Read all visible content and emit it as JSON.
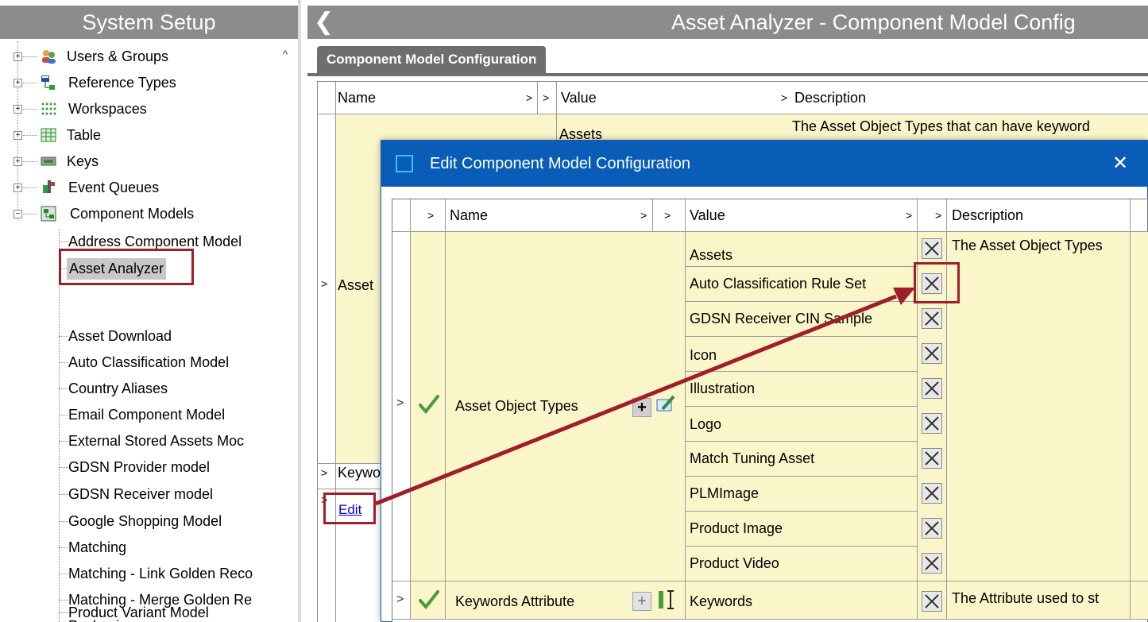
{
  "left_panel": {
    "title": "System Setup",
    "tree": [
      {
        "label": "Users & Groups",
        "icon": "users-groups-icon"
      },
      {
        "label": "Reference Types",
        "icon": "reference-types-icon"
      },
      {
        "label": "Workspaces",
        "icon": "workspaces-icon"
      },
      {
        "label": "Table",
        "icon": "table-icon"
      },
      {
        "label": "Keys",
        "icon": "keys-icon"
      },
      {
        "label": "Event Queues",
        "icon": "event-queues-icon"
      },
      {
        "label": "Component Models",
        "icon": "component-models-icon"
      }
    ],
    "component_models": [
      "Address Component Model",
      "Asset Analyzer",
      "Asset Download",
      "Auto Classification Model",
      "Country Aliases",
      "Email Component Model",
      "External Stored Assets Moc",
      "GDSN Provider model",
      "GDSN Receiver model",
      "Google Shopping Model",
      "Matching",
      "Matching - Link Golden Reco",
      "Matching - Merge Golden Re",
      "Packaging",
      "Product Variant Model"
    ],
    "selected": "Asset Analyzer"
  },
  "right_panel": {
    "title": "Asset Analyzer - Component Model Config",
    "tab": "Component Model Configuration",
    "columns": {
      "name": "Name",
      "value": "Value",
      "description": "Description"
    },
    "rows": [
      {
        "name": "Asset",
        "value": "Assets",
        "description": "The Asset Object Types that can have keyword"
      },
      {
        "name": "Keywo"
      }
    ],
    "edit_link": "Edit"
  },
  "dialog": {
    "title": "Edit Component Model Configuration",
    "columns": {
      "name": "Name",
      "value": "Value",
      "description": "Description"
    },
    "rows": [
      {
        "name": "Asset Object Types",
        "description": "The Asset Object Types",
        "values": [
          "Assets",
          "Auto Classification Rule Set",
          "GDSN Receiver CIN Sample",
          "Icon",
          "Illustration",
          "Logo",
          "Match Tuning Asset",
          "PLMImage",
          "Product Image",
          "Product Video"
        ]
      },
      {
        "name": "Keywords Attribute",
        "value": "Keywords",
        "description": "The Attribute used to st"
      }
    ]
  },
  "colors": {
    "header_gray": "#8c8c8c",
    "tab_gray": "#6e6e6e",
    "row_yellow": "#fbf6c9",
    "dialog_titlebar": "#0a5db6",
    "annotation_red": "#a01e2a",
    "link_blue": "#0000ee"
  }
}
